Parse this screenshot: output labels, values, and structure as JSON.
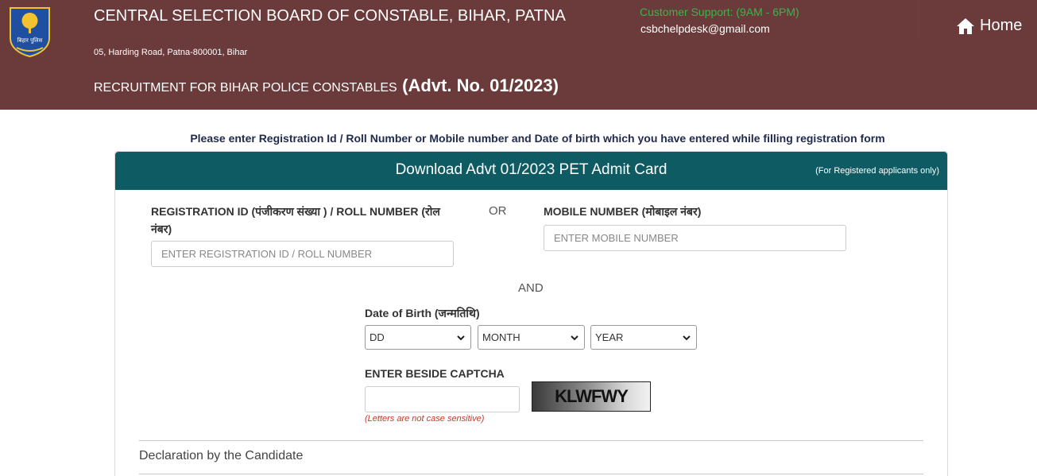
{
  "header": {
    "org_name": "CENTRAL SELECTION BOARD OF CONSTABLE, BIHAR, PATNA",
    "address": "05, Harding Road, Patna-800001, Bihar",
    "recruitment_text": "RECRUITMENT FOR BIHAR POLICE CONSTABLES",
    "advt_no": "(Advt. No. 01/2023)",
    "logo_text": "बिहार पुलिस",
    "support_label": "Customer Support: (9AM - 6PM)",
    "support_email": "csbchelpdesk@gmail.com",
    "home_label": "Home"
  },
  "instruction": "Please enter Registration Id / Roll Number or Mobile number and Date of birth which you have entered while filling registration form",
  "card": {
    "title": "Download Advt 01/2023 PET Admit Card",
    "note": "(For Registered applicants only)"
  },
  "form": {
    "reg_label": "REGISTRATION ID (पंजीकरण संख्या ) / ROLL NUMBER (रोल नंबर)",
    "reg_placeholder": "ENTER REGISTRATION ID / ROLL NUMBER",
    "or_text": "OR",
    "mobile_label": "MOBILE NUMBER (मोबाइल नंबर)",
    "mobile_placeholder": "ENTER MOBILE NUMBER",
    "and_text": "AND",
    "dob_label": "Date of Birth (जन्मतिथि)",
    "dob_day": "DD",
    "dob_month": "MONTH",
    "dob_year": "YEAR",
    "captcha_label": "ENTER BESIDE CAPTCHA",
    "captcha_value": "",
    "captcha_text": "KLWFWY",
    "captcha_hint": "(Letters are not case sensitive)",
    "declaration_title": "Declaration by the Candidate"
  },
  "colors": {
    "header_bg": "#6b3a3b",
    "card_header_bg": "#0f5b63",
    "support_text": "#39b54a",
    "hint_text": "#c0392b"
  }
}
